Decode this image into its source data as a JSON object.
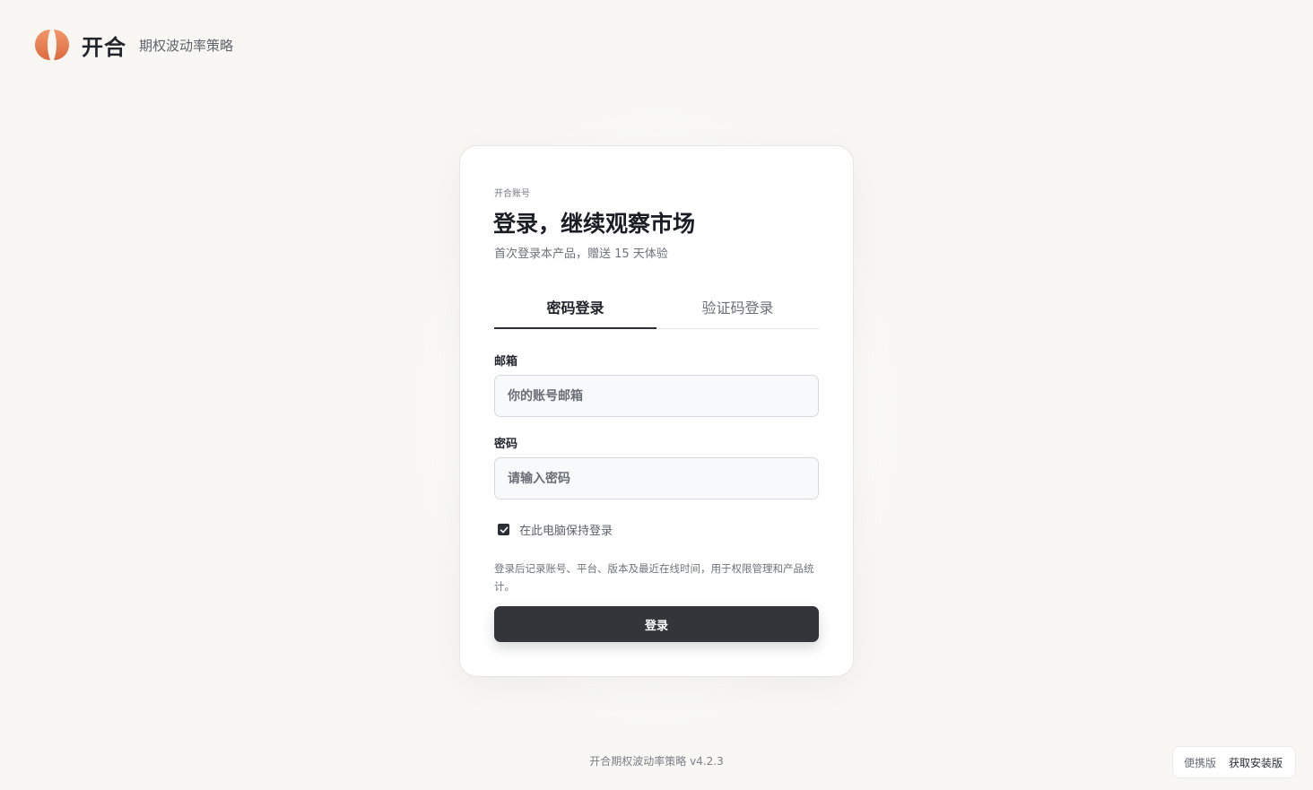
{
  "brand": {
    "logo_icon": "split-orange-circle-icon",
    "name": "开合",
    "subtitle": "期权波动率策略",
    "accent_color": "#e57848"
  },
  "login": {
    "eyebrow": "开合账号",
    "title": "登录，继续观察市场",
    "subtitle": "首次登录本产品，赠送 15 天体验",
    "tabs": [
      {
        "label": "密码登录",
        "active": true
      },
      {
        "label": "验证码登录",
        "active": false
      }
    ],
    "email": {
      "label": "邮箱",
      "value": "",
      "placeholder": "你的账号邮箱"
    },
    "password": {
      "label": "密码",
      "value": "",
      "placeholder": "请输入密码"
    },
    "remember": {
      "label": "在此电脑保持登录",
      "checked": true
    },
    "notice": "登录后记录账号、平台、版本及最近在线时间，用于权限管理和产品统计。",
    "submit_label": "登录",
    "button_color": "#33353b"
  },
  "footer": {
    "text": "开合期权波动率策略 v4.2.3"
  },
  "corner": {
    "portable_label": "便携版",
    "install_label": "获取安装版"
  }
}
